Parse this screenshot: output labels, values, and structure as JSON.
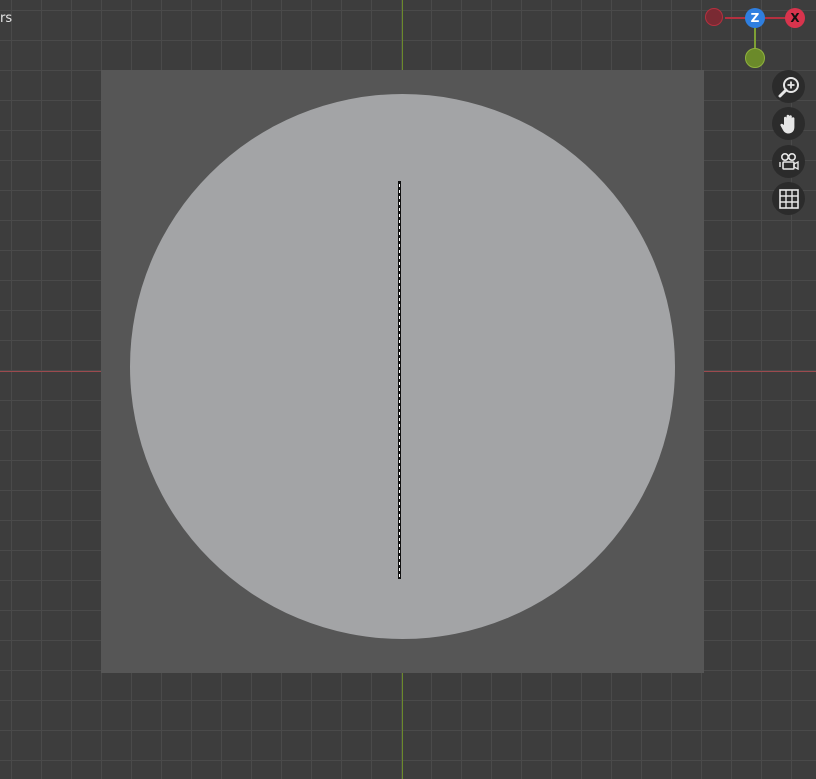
{
  "header": {
    "partial_label": "rs"
  },
  "gizmo": {
    "z_label": "Z",
    "x_label": "X",
    "colors": {
      "z": "#2f7fe0",
      "x": "#d8344d",
      "x_negative": "#7a2a33",
      "y_negative": "#6b8a2a"
    }
  },
  "toolbar": {
    "tools": [
      {
        "name": "zoom",
        "icon": "zoom-in-icon"
      },
      {
        "name": "pan",
        "icon": "hand-icon"
      },
      {
        "name": "camera",
        "icon": "camera-view-icon"
      },
      {
        "name": "grid",
        "icon": "grid-icon"
      }
    ]
  },
  "colors": {
    "viewport_background": "#3d3d3d",
    "grid_line": "#4a4a4a",
    "image_plane": "#565656",
    "disc": "#a3a4a6",
    "x_axis": "#9c4a4e",
    "y_axis": "#6b8a2a"
  }
}
